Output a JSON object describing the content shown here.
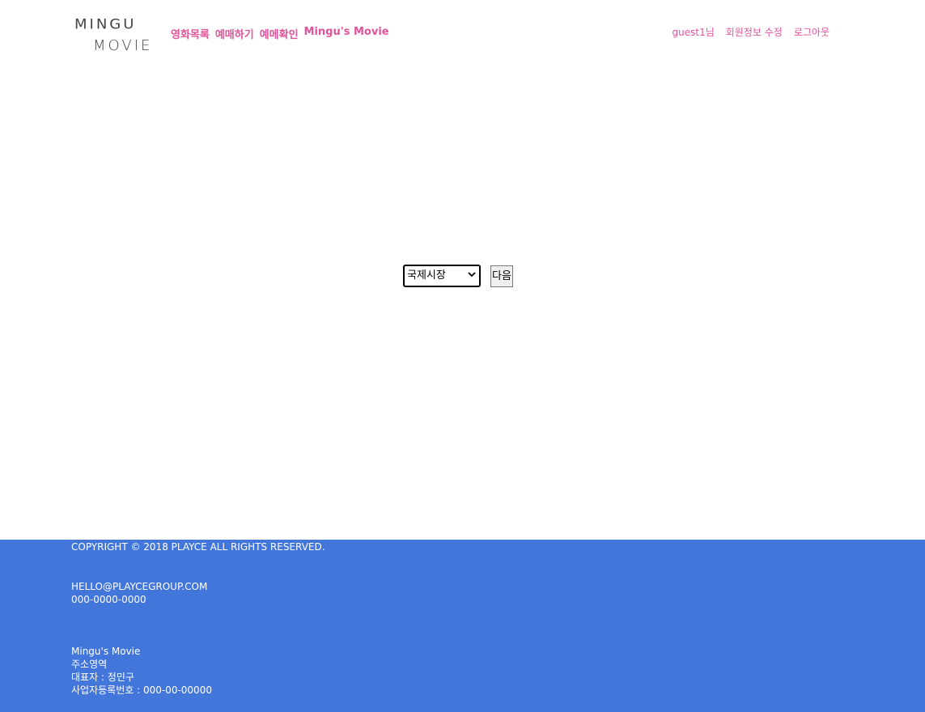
{
  "header": {
    "logo_line1": "MINGU",
    "logo_line2": "MOVIE",
    "nav": [
      "영화목록",
      "예매하기",
      "예메확인",
      "Mingu's Movie"
    ],
    "user_nav": [
      "guest1님",
      "회원정보 수정",
      "로그아웃"
    ]
  },
  "form": {
    "theater_select_value": "국제시장",
    "next_label": "다음"
  },
  "footer": {
    "copyright": "COPYRIGHT © 2018 PLAYCE ALL RIGHTS RESERVED.",
    "email": "HELLO@PLAYCEGROUP.COM",
    "phone": "000-0000-0000",
    "company_name": "Mingu's Movie",
    "address": "주소영역",
    "ceo": "대표자 : 정민구",
    "business_no": "사업자등록번호 : 000-00-00000"
  },
  "colors": {
    "accent": "#e0559a",
    "footer_bg": "#4376db"
  }
}
